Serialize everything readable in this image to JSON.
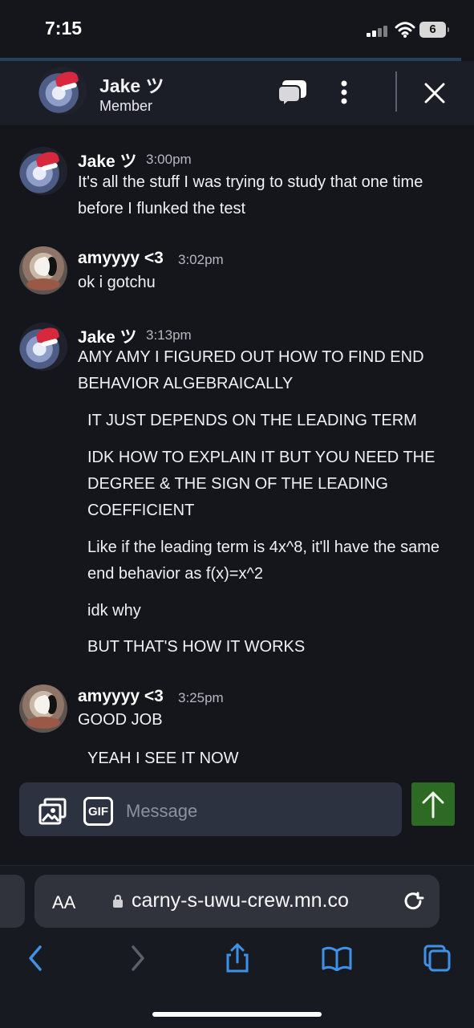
{
  "status_bar": {
    "time": "7:15",
    "battery": "6"
  },
  "header": {
    "name": "Jake ツ",
    "role": "Member"
  },
  "messages": [
    {
      "name": "Jake ツ",
      "time": "3:00pm",
      "lines": [
        "It's all the stuff I was trying to study that one time before I flunked the test"
      ]
    },
    {
      "name": "amyyyy <3",
      "time": "3:02pm",
      "lines": [
        "ok i gotchu"
      ]
    },
    {
      "name": "Jake ツ",
      "time": "3:13pm",
      "lines": [
        "AMY AMY I FIGURED OUT HOW TO FIND END BEHAVIOR ALGEBRAICALLY",
        "IT JUST DEPENDS ON THE LEADING TERM",
        "IDK HOW TO EXPLAIN IT BUT YOU NEED THE DEGREE & THE SIGN OF THE LEADING COEFFICIENT",
        "Like if the leading term is 4x^8, it'll have the same end behavior as f(x)=x^2",
        "idk why",
        "BUT THAT'S HOW IT WORKS"
      ]
    },
    {
      "name": "amyyyy <3",
      "time": "3:25pm",
      "lines": [
        "GOOD JOB",
        "YEAH I SEE IT NOW"
      ]
    }
  ],
  "composer": {
    "gif_label": "GIF",
    "placeholder": "Message"
  },
  "browser": {
    "aa_label": "AA",
    "url": "carny-s-uwu-crew.mn.co"
  },
  "icons": {
    "chat": "chat-bubbles-icon",
    "more": "more-vertical-icon",
    "close": "close-icon",
    "image": "image-upload-icon",
    "send": "send-arrow-icon",
    "back": "back-icon",
    "forward": "forward-icon",
    "share": "share-icon",
    "bookmarks": "bookmarks-icon",
    "tabs": "tabs-icon"
  },
  "colors": {
    "background": "#15151c",
    "header": "#1b1d27",
    "composer": "#2d3240",
    "send": "#2d6a24",
    "link": "#3f91e8"
  }
}
